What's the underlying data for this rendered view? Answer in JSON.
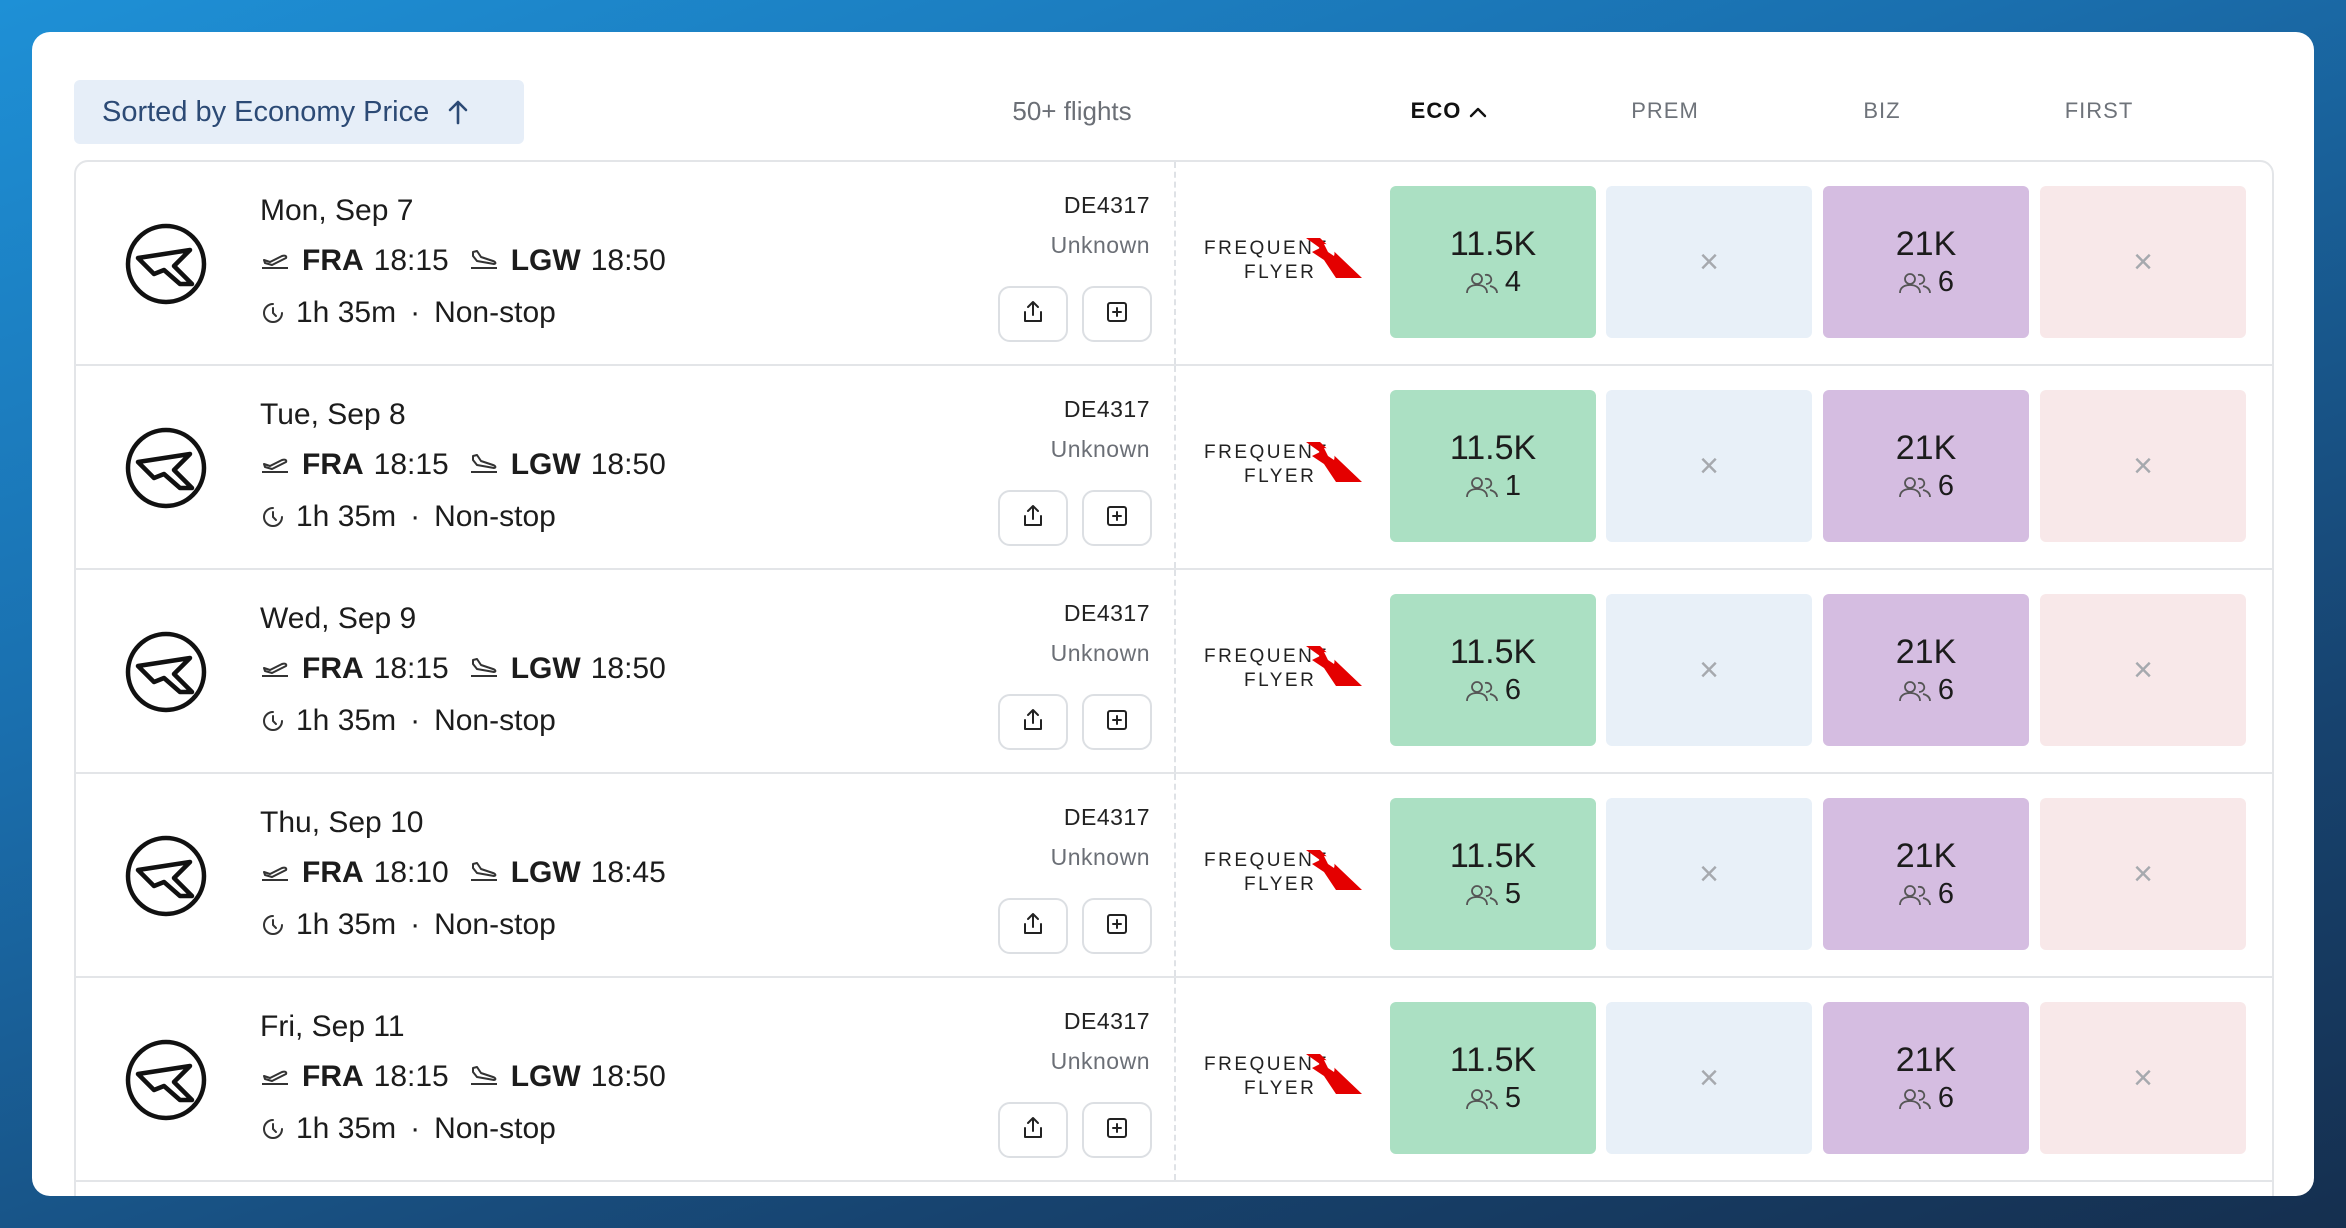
{
  "toolbar": {
    "sort_label": "Sorted by Economy Price",
    "flight_count": "50+ flights"
  },
  "columns": {
    "eco": "ECO",
    "prem": "PREM",
    "biz": "BIZ",
    "first": "FIRST"
  },
  "program": {
    "line1": "FREQUENT",
    "line2": "FLYER",
    "brand_color": "#e40000"
  },
  "colors": {
    "eco_cell": "#abe0c3",
    "prem_cell": "#e8f0f8",
    "biz_cell": "#d5bde1",
    "first_cell": "#f8e8e9"
  },
  "flights": [
    {
      "date": "Mon, Sep 7",
      "origin": "FRA",
      "dep_time": "18:15",
      "destination": "LGW",
      "arr_time": "18:50",
      "duration": "1h 35m",
      "dot": "·",
      "stops": "Non-stop",
      "flight_number": "DE4317",
      "aircraft": "Unknown",
      "eco": {
        "price": "11.5K",
        "seats": "4"
      },
      "prem": "×",
      "biz": {
        "price": "21K",
        "seats": "6"
      },
      "first": "×"
    },
    {
      "date": "Tue, Sep 8",
      "origin": "FRA",
      "dep_time": "18:15",
      "destination": "LGW",
      "arr_time": "18:50",
      "duration": "1h 35m",
      "dot": "·",
      "stops": "Non-stop",
      "flight_number": "DE4317",
      "aircraft": "Unknown",
      "eco": {
        "price": "11.5K",
        "seats": "1"
      },
      "prem": "×",
      "biz": {
        "price": "21K",
        "seats": "6"
      },
      "first": "×"
    },
    {
      "date": "Wed, Sep 9",
      "origin": "FRA",
      "dep_time": "18:15",
      "destination": "LGW",
      "arr_time": "18:50",
      "duration": "1h 35m",
      "dot": "·",
      "stops": "Non-stop",
      "flight_number": "DE4317",
      "aircraft": "Unknown",
      "eco": {
        "price": "11.5K",
        "seats": "6"
      },
      "prem": "×",
      "biz": {
        "price": "21K",
        "seats": "6"
      },
      "first": "×"
    },
    {
      "date": "Thu, Sep 10",
      "origin": "FRA",
      "dep_time": "18:10",
      "destination": "LGW",
      "arr_time": "18:45",
      "duration": "1h 35m",
      "dot": "·",
      "stops": "Non-stop",
      "flight_number": "DE4317",
      "aircraft": "Unknown",
      "eco": {
        "price": "11.5K",
        "seats": "5"
      },
      "prem": "×",
      "biz": {
        "price": "21K",
        "seats": "6"
      },
      "first": "×"
    },
    {
      "date": "Fri, Sep 11",
      "origin": "FRA",
      "dep_time": "18:15",
      "destination": "LGW",
      "arr_time": "18:50",
      "duration": "1h 35m",
      "dot": "·",
      "stops": "Non-stop",
      "flight_number": "DE4317",
      "aircraft": "Unknown",
      "eco": {
        "price": "11.5K",
        "seats": "5"
      },
      "prem": "×",
      "biz": {
        "price": "21K",
        "seats": "6"
      },
      "first": "×"
    }
  ]
}
